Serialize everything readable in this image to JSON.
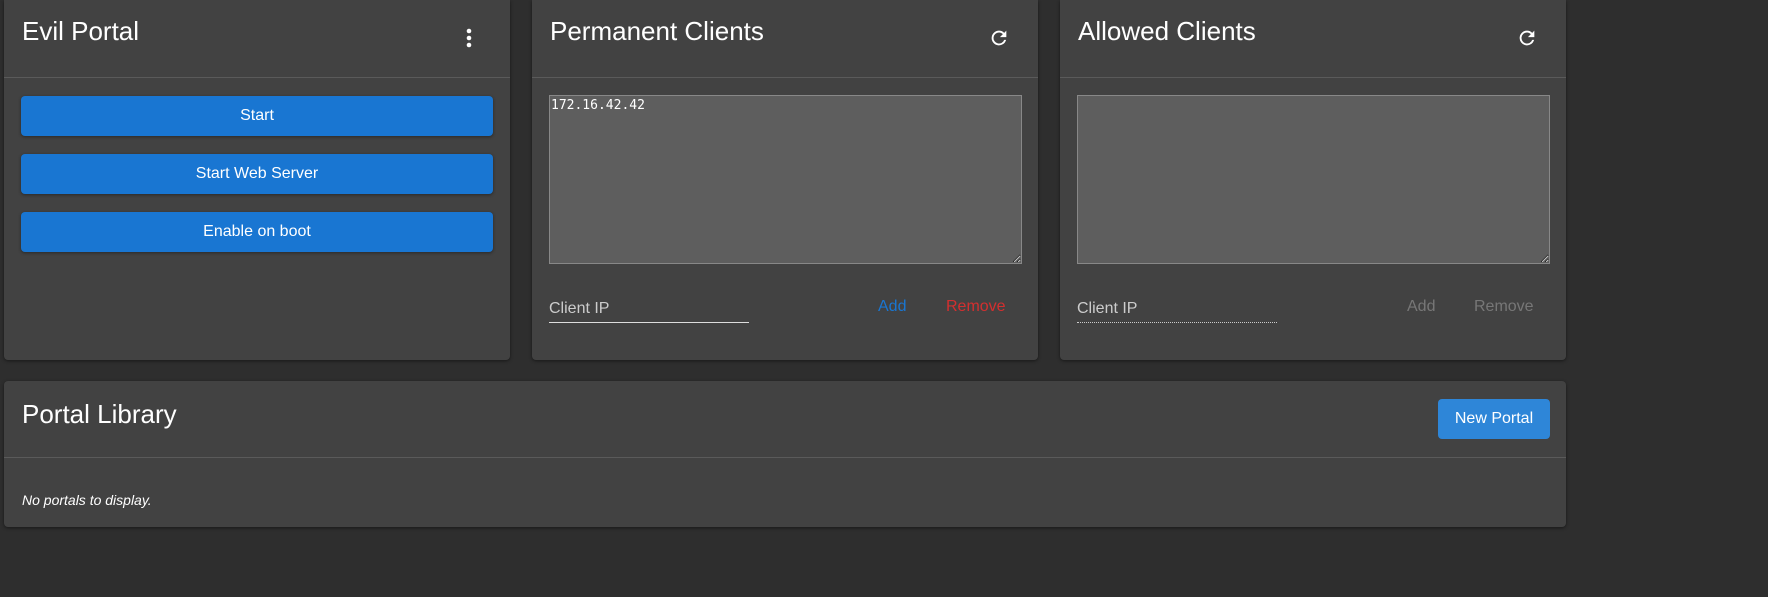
{
  "evil_portal": {
    "title": "Evil Portal",
    "buttons": [
      "Start",
      "Start Web Server",
      "Enable on boot"
    ]
  },
  "permanent_clients": {
    "title": "Permanent Clients",
    "textarea_value": "172.16.42.42",
    "input_placeholder": "Client IP",
    "add_label": "Add",
    "remove_label": "Remove"
  },
  "allowed_clients": {
    "title": "Allowed Clients",
    "textarea_value": "",
    "input_placeholder": "Client IP",
    "add_label": "Add",
    "remove_label": "Remove"
  },
  "portal_library": {
    "title": "Portal Library",
    "new_portal_label": "New Portal",
    "empty_text": "No portals to display."
  },
  "colors": {
    "primary": "#1976d2",
    "danger": "#d32f2f",
    "card": "#424242",
    "background": "#2e2e2e"
  }
}
